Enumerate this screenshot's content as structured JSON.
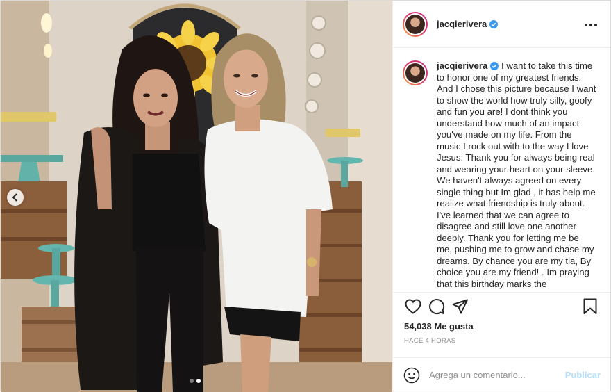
{
  "post": {
    "username": "jacqierivera",
    "verified": true,
    "more_icon": "more-horizontal-icon",
    "caption_username": "jacqierivera",
    "caption_text": "I want to take this time to honor one of my greatest friends. And I chose this picture because I want to show the world how truly silly, goofy and fun you are! I dont think you understand how much of an impact you've made on my life. From the music I rock out with to the way I love Jesus. Thank you for always being real and wearing your heart on your sleeve. We haven't always agreed on every single thing but Im glad , it has help me realize what friendship is truly about. I've learned that we can agree to disagree and still love one another deeply. Thank you for letting me be me, pushing me to grow and chase my dreams. By chance you are my tia, By choice you are my friend! . Im praying that this birthday marks the",
    "likes": "54,038 Me gusta",
    "timestamp": "HACE 4 HORAS"
  },
  "actions": {
    "like_icon": "heart-icon",
    "comment_icon": "comment-icon",
    "share_icon": "share-icon",
    "save_icon": "bookmark-icon"
  },
  "comment": {
    "placeholder": "Agrega un comentario...",
    "emoji_icon": "emoji-icon",
    "submit_label": "Publicar"
  },
  "carousel": {
    "prev_icon": "chevron-left-icon",
    "total": 2,
    "current": 2
  },
  "colors": {
    "verified": "#3897f0",
    "submit_disabled": "#b2dffc",
    "muted": "#8e8e8e",
    "border": "#dbdbdb"
  }
}
